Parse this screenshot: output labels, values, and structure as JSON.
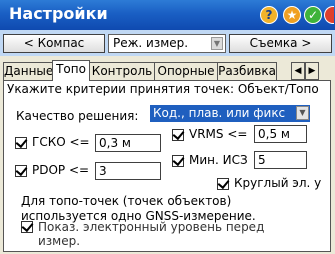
{
  "window": {
    "title": "Настройки",
    "buttons": [
      "?",
      "★",
      "✓",
      "✕"
    ]
  },
  "toolbar": {
    "compass_label": "< Компас",
    "mode_label": "Реж. измер.",
    "survey_label": "Съемка >"
  },
  "tabs": [
    "Данные",
    "Топо",
    "Контроль",
    "Опорные",
    "Разбивка"
  ],
  "active_tab": "Топо",
  "panel": {
    "instruction": "Укажите критерии принятия точек: Объект/Топо",
    "quality_label": "Качество решения:",
    "quality_value": "Код., плав. или фикс",
    "hrms": {
      "label": "ГСКО <=",
      "value": "0,3 м",
      "checked": true
    },
    "vrms": {
      "label": "VRMS <=",
      "value": "0,5 м",
      "checked": true
    },
    "pdop": {
      "label": "PDOP <=",
      "value": "3",
      "checked": true
    },
    "min_sats": {
      "label": "Мин. ИСЗ",
      "value": "5",
      "checked": true
    },
    "round_level": {
      "label": "Круглый эл. у",
      "checked": true
    },
    "note_line1": "Для топо-точек (точек объектов)",
    "note_line2": "используется одно GNSS-измерение.",
    "show_level": {
      "label": "Показ. электронный уровень перед",
      "label2": "измер.",
      "checked": true
    }
  },
  "colors": {
    "titlebar": "#1a5fc4",
    "toolbar": "#c0d8f4",
    "selection": "#1f5fbf",
    "background": "#ece9d8"
  }
}
